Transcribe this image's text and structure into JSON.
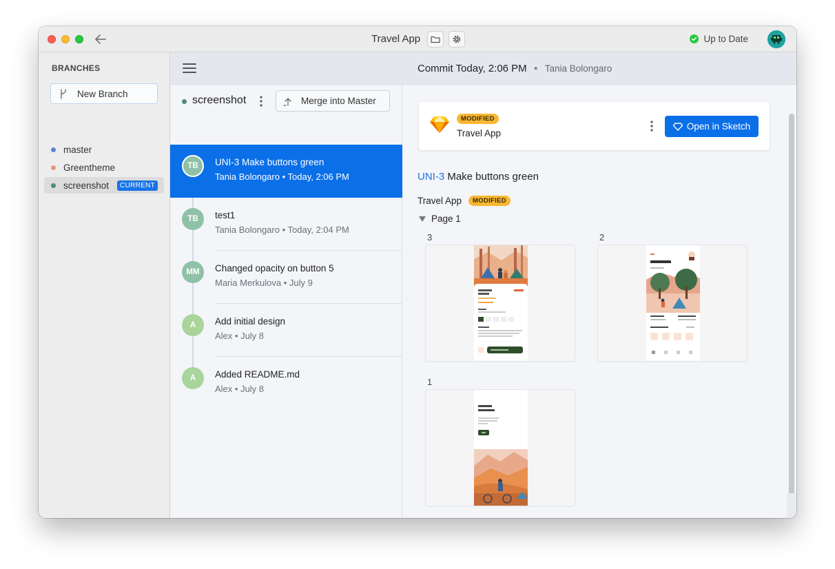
{
  "window": {
    "title": "Travel App",
    "status": "Up to Date"
  },
  "sidebar": {
    "title": "BRANCHES",
    "new_branch_label": "New Branch",
    "branches": [
      {
        "name": "master",
        "color": "#5b84d6"
      },
      {
        "name": "Greentheme",
        "color": "#e59a7c"
      },
      {
        "name": "screenshot",
        "color": "#4a8b80",
        "badge": "CURRENT"
      }
    ]
  },
  "commit_list": {
    "branch_name": "screenshot",
    "merge_label": "Merge into Master",
    "commits": [
      {
        "initials": "TB",
        "message": "UNI-3 Make buttons green",
        "meta": "Tania Bolongaro • Today, 2:06 PM",
        "avatar_color": "#8fc1a6",
        "selected": true
      },
      {
        "initials": "TB",
        "message": "test1",
        "meta": "Tania Bolongaro • Today, 2:04 PM",
        "avatar_color": "#8fc1a6"
      },
      {
        "initials": "MM",
        "message": "Changed opacity on button 5",
        "meta": "Maria Merkulova • July 9",
        "avatar_color": "#8fc1a6"
      },
      {
        "initials": "A",
        "message": "Add initial design",
        "meta": "Alex • July 8",
        "avatar_color": "#a9d49b"
      },
      {
        "initials": "A",
        "message": "Added README.md",
        "meta": "Alex • July 8",
        "avatar_color": "#a9d49b"
      }
    ]
  },
  "detail": {
    "header_title": "Commit Today, 2:06 PM",
    "header_author": "Tania Bolongaro",
    "file_card": {
      "badge": "MODIFIED",
      "name": "Travel App",
      "open_label": "Open in Sketch"
    },
    "commit_issue": "UNI-3",
    "commit_text": " Make buttons green",
    "document": {
      "name": "Travel App",
      "badge": "MODIFIED"
    },
    "page_name": "Page 1",
    "artboards": [
      {
        "label": "3",
        "kind": "forest",
        "title": "Forest Camping",
        "price": "$299"
      },
      {
        "label": "2",
        "kind": "explore",
        "title": "Find more"
      },
      {
        "label": "1",
        "kind": "biking",
        "title": "Biking Mountain"
      }
    ]
  }
}
